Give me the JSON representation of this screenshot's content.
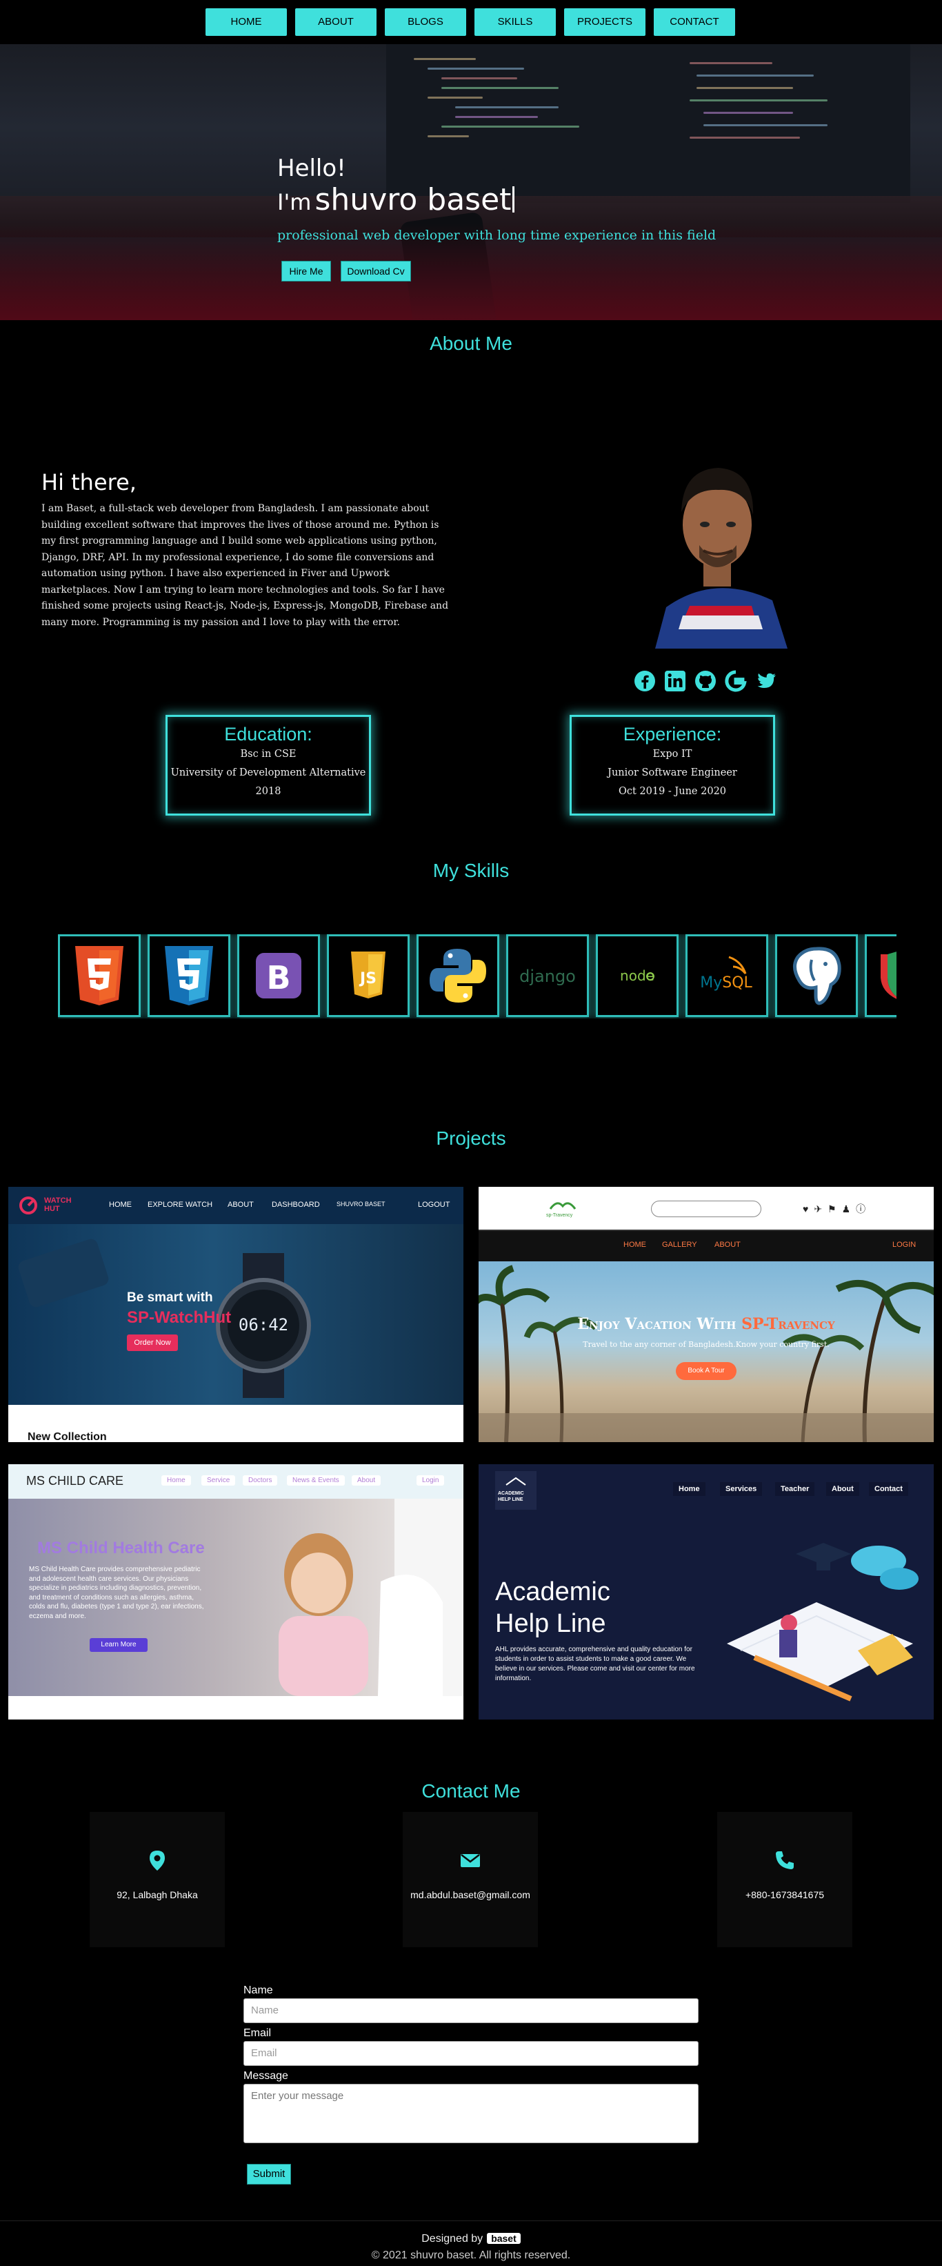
{
  "nav": {
    "items": [
      "HOME",
      "ABOUT",
      "BLOGS",
      "SKILLS",
      "PROJECTS",
      "CONTACT"
    ]
  },
  "hero": {
    "hello": "Hello!",
    "im_prefix": "I'm",
    "name": "shuvro baset",
    "tagline": "professional web developer with long time experience in this field",
    "hire_btn": "Hire Me",
    "cv_btn": "Download Cv"
  },
  "about": {
    "title": "About Me",
    "greeting": "Hi there,",
    "bio": "I am Baset, a full-stack web developer from Bangladesh. I am passionate about building excellent software that improves the lives of those around me. Python is my first programming language and I build some web applications using python, Django, DRF, API. In my professional experience, I do some file conversions and automation using python. I have also experienced in Fiver and Upwork marketplaces. Now I am trying to learn more technologies and tools. So far I have finished some projects using React-js, Node-js, Express-js, MongoDB, Firebase and many more. Programming is my passion and I love to play with the error.",
    "social": [
      "facebook-icon",
      "linkedin-icon",
      "github-icon",
      "google-icon",
      "twitter-icon"
    ],
    "education": {
      "heading": "Education:",
      "lines": [
        "Bsc in CSE",
        "University of Development Alternative",
        "2018"
      ]
    },
    "experience": {
      "heading": "Experience:",
      "lines": [
        "Expo IT",
        "Junior Software Engineer",
        "Oct 2019 - June 2020"
      ]
    }
  },
  "skills": {
    "title": "My Skills",
    "items": [
      "HTML5",
      "CSS3",
      "Bootstrap",
      "JS",
      "Python",
      "django",
      "node",
      "MySQL",
      "PostgreSQL",
      "Shield"
    ]
  },
  "projects": {
    "title": "Projects",
    "watchhut": {
      "logo": "WATCH HUT",
      "nav": [
        "HOME",
        "EXPLORE WATCH",
        "ABOUT",
        "DASHBOARD",
        "SHUVRO BASET",
        "LOGOUT"
      ],
      "headline1": "Be smart with",
      "headline2": "SP-WatchHut",
      "order_btn": "Order Now",
      "watch_time": "06:42",
      "new_collection": "New Collection"
    },
    "travency": {
      "logo": "sp-Travency",
      "nav": [
        "HOME",
        "GALLERY",
        "ABOUT"
      ],
      "login": "LOGIN",
      "headline_a": "Enjoy Vacation With",
      "headline_b": "SP-Travency",
      "sub": "Travel to the any corner of Bangladesh.Know your country first.",
      "btn": "Book A Tour"
    },
    "childcare": {
      "logo": "MS CHILD CARE",
      "nav": [
        "Home",
        "Service",
        "Doctors",
        "News & Events",
        "About"
      ],
      "login": "Login",
      "headline": "MS Child Health Care",
      "text": "MS Child Health Care provides comprehensive pediatric and adolescent health care services. Our physicians specialize in pediatrics including diagnostics, prevention, and treatment of conditions such as allergies, asthma, colds and flu, diabetes (type 1 and type 2), ear infections, eczema and more.",
      "btn": "Learn More"
    },
    "helpline": {
      "logo": "ACADEMIC HELP LINE",
      "nav": [
        "Home",
        "Services",
        "Teacher",
        "About",
        "Contact"
      ],
      "headline1": "Academic",
      "headline2": "Help Line",
      "text": "AHL provides accurate, comprehensive and quality education for students in order to assist students to make a good career. We believe in our services. Please come and visit our center for more information."
    }
  },
  "contact": {
    "title": "Contact Me",
    "address": "92, Lalbagh Dhaka",
    "email": "md.abdul.baset@gmail.com",
    "phone": "+880-1673841675",
    "form": {
      "name_label": "Name",
      "name_placeholder": "Name",
      "email_label": "Email",
      "email_placeholder": "Email",
      "message_label": "Message",
      "message_placeholder": "Enter your message",
      "submit": "Submit"
    }
  },
  "footer": {
    "designed_by": "Designed by",
    "badge": "baset",
    "copyright": "© 2021 shuvro baset. All rights reserved."
  },
  "colors": {
    "accent": "#3fe0dc",
    "background": "#000000"
  }
}
